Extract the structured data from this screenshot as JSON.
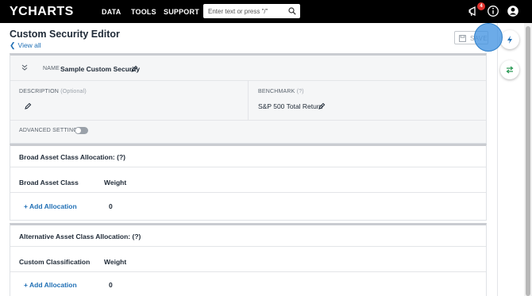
{
  "nav": {
    "logo_first": "Y",
    "logo_rest": "CHARTS",
    "links": [
      "DATA",
      "TOOLS",
      "SUPPORT"
    ],
    "search_placeholder": "Enter text or press \"/\"",
    "notification_count": "4"
  },
  "header": {
    "title": "Custom Security Editor",
    "view_all": "View all",
    "save_label": "SAVE"
  },
  "security": {
    "name_label": "NAME",
    "name_value": "Sample Custom Security",
    "description_label": "DESCRIPTION",
    "description_optional": "(Optional)",
    "benchmark_label": "BENCHMARK",
    "benchmark_help": "(?)",
    "benchmark_value": "S&P 500 Total Return",
    "advanced_label": "ADVANCED SETTINGS"
  },
  "broad": {
    "title": "Broad Asset Class Allocation: (?)",
    "col1": "Broad Asset Class",
    "col2": "Weight",
    "add": "+ Add Allocation",
    "weight_value": "0"
  },
  "alternative": {
    "title": "Alternative Asset Class Allocation: (?)",
    "col1": "Custom Classification",
    "col2": "Weight",
    "add": "+ Add Allocation",
    "weight_value": "0"
  },
  "colors": {
    "nav_bg": "#000000",
    "link_blue": "#1f6fb5",
    "badge_red": "#e0332e",
    "highlight": "#4294e2"
  },
  "icons": [
    "search-icon",
    "megaphone-icon",
    "info-icon",
    "user-icon",
    "lightning-icon",
    "swap-icon",
    "save-icon",
    "pencil-icon",
    "chevron-left-icon",
    "collapse-chevron-icon"
  ]
}
